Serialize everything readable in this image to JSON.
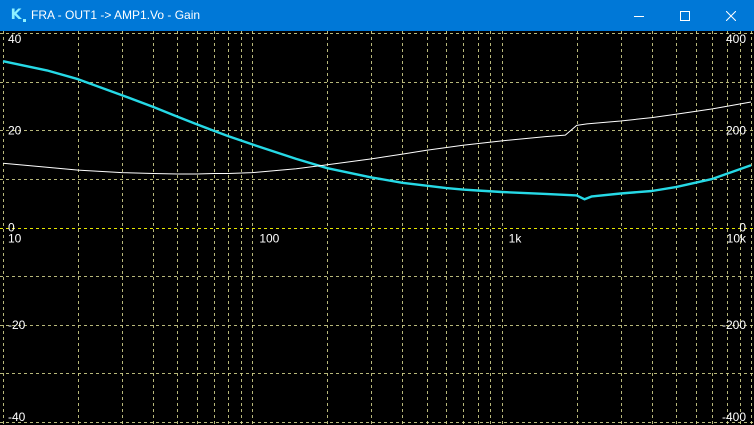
{
  "window": {
    "title": "FRA - OUT1 -> AMP1.Vo - Gain",
    "icon": "k-logo-icon",
    "controls": [
      "minimize-icon",
      "maximize-icon",
      "close-icon"
    ]
  },
  "colors": {
    "titlebar": "#0078d7",
    "background": "#000000",
    "grid": "#d8d890",
    "gain_trace": "#26d9e6",
    "phase_trace": "#ffffff",
    "zero_line": "#e6e600"
  },
  "chart_data": {
    "type": "line",
    "x_scale": "log",
    "xlim": [
      10,
      10000
    ],
    "ylim_left": [
      -40,
      40
    ],
    "ylim_right": [
      -400,
      400
    ],
    "x_tick_labels": [
      "10",
      "100",
      "1k",
      "10k"
    ],
    "y_left_tick_labels": [
      "40",
      "20",
      "0",
      "-20",
      "-40"
    ],
    "y_right_tick_labels": [
      "400",
      "200",
      "0",
      "-200",
      "-400"
    ],
    "grid": true,
    "series": [
      {
        "axis": "left",
        "color": "#26d9e6",
        "x": [
          10,
          15,
          20,
          30,
          40,
          50,
          60,
          70,
          80,
          100,
          150,
          200,
          300,
          400,
          500,
          600,
          700,
          800,
          1000,
          1500,
          2000,
          2150,
          2300,
          3000,
          4000,
          5000,
          7000,
          10000
        ],
        "y": [
          34.2,
          32.3,
          30.5,
          27.2,
          24.8,
          22.8,
          21.2,
          19.9,
          18.8,
          17.1,
          14.1,
          12.2,
          10.3,
          9.2,
          8.6,
          8.1,
          7.8,
          7.6,
          7.3,
          6.9,
          6.6,
          5.8,
          6.4,
          7.0,
          7.5,
          8.3,
          10.0,
          12.8
        ]
      },
      {
        "axis": "right",
        "color": "#ffffff",
        "x": [
          10,
          15,
          20,
          30,
          40,
          50,
          60,
          70,
          80,
          100,
          150,
          200,
          300,
          400,
          500,
          700,
          1000,
          1500,
          1800,
          2000,
          2200,
          3000,
          4000,
          5000,
          7000,
          10000
        ],
        "y": [
          132,
          124,
          118,
          113,
          111,
          110,
          110,
          111,
          111,
          113,
          121,
          129,
          141,
          151,
          159,
          169,
          178,
          187,
          190,
          210,
          213,
          219,
          226,
          233,
          244,
          258
        ]
      }
    ]
  }
}
